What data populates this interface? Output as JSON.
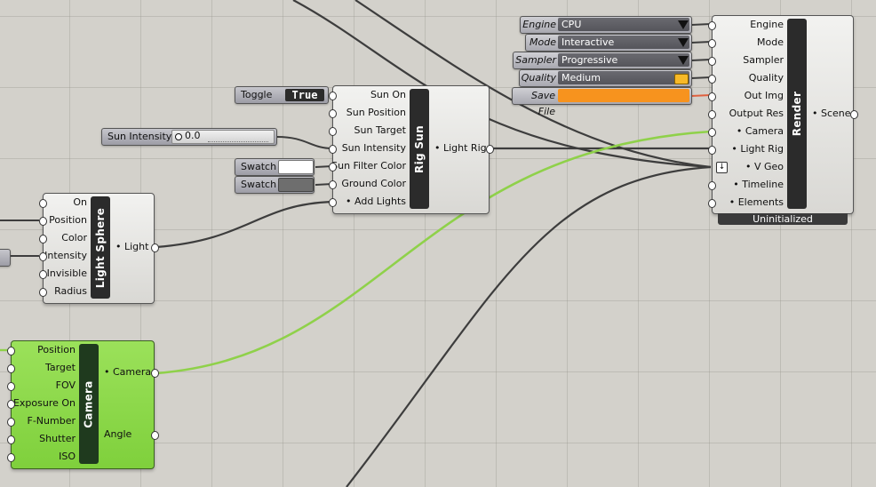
{
  "light_sphere": {
    "title": "Light Sphere",
    "inputs": [
      "On",
      "Position",
      "Color",
      "Intensity",
      "Invisible",
      "Radius"
    ],
    "output": "• Light"
  },
  "camera": {
    "title": "Camera",
    "inputs": [
      "Position",
      "Target",
      "FOV",
      "Exposure On",
      "F-Number",
      "Shutter",
      "ISO"
    ],
    "outputs": [
      "• Camera",
      "Angle"
    ]
  },
  "rig_sun": {
    "title": "Rig Sun",
    "inputs": [
      "Sun On",
      "Sun Position",
      "Sun Target",
      "Sun Intensity",
      "Sun Filter Color",
      "Ground Color",
      "• Add Lights"
    ],
    "output": "• Light Rig"
  },
  "render": {
    "title": "Render",
    "inputs": [
      "Engine",
      "Mode",
      "Sampler",
      "Quality",
      "Out Img",
      "Output Res",
      "• Camera",
      "• Light Rig",
      "• V Geo",
      "• Timeline",
      "• Elements"
    ],
    "output": "• Scene",
    "status": "Uninitialized"
  },
  "toggle": {
    "label": "Toggle",
    "value": "True"
  },
  "sun_intensity_slider": {
    "label": "Sun Intensity",
    "value": "0.0"
  },
  "swatches": [
    {
      "label": "Swatch",
      "color": "#ffffff"
    },
    {
      "label": "Swatch",
      "color": "#6e6e6e"
    }
  ],
  "value_lists": [
    {
      "name": "Engine",
      "value": "CPU"
    },
    {
      "name": "Mode",
      "value": "Interactive"
    },
    {
      "name": "Sampler",
      "value": "Progressive"
    },
    {
      "name": "Quality",
      "value": "Medium"
    },
    {
      "name": "Save File",
      "value": ""
    }
  ],
  "colors": {
    "canvas": "#d3d1cb",
    "wire_default": "#3d3d3d",
    "wire_camera": "#8fd14a",
    "wire_error": "#e0603e",
    "save_file_accent": "#f7931e"
  }
}
